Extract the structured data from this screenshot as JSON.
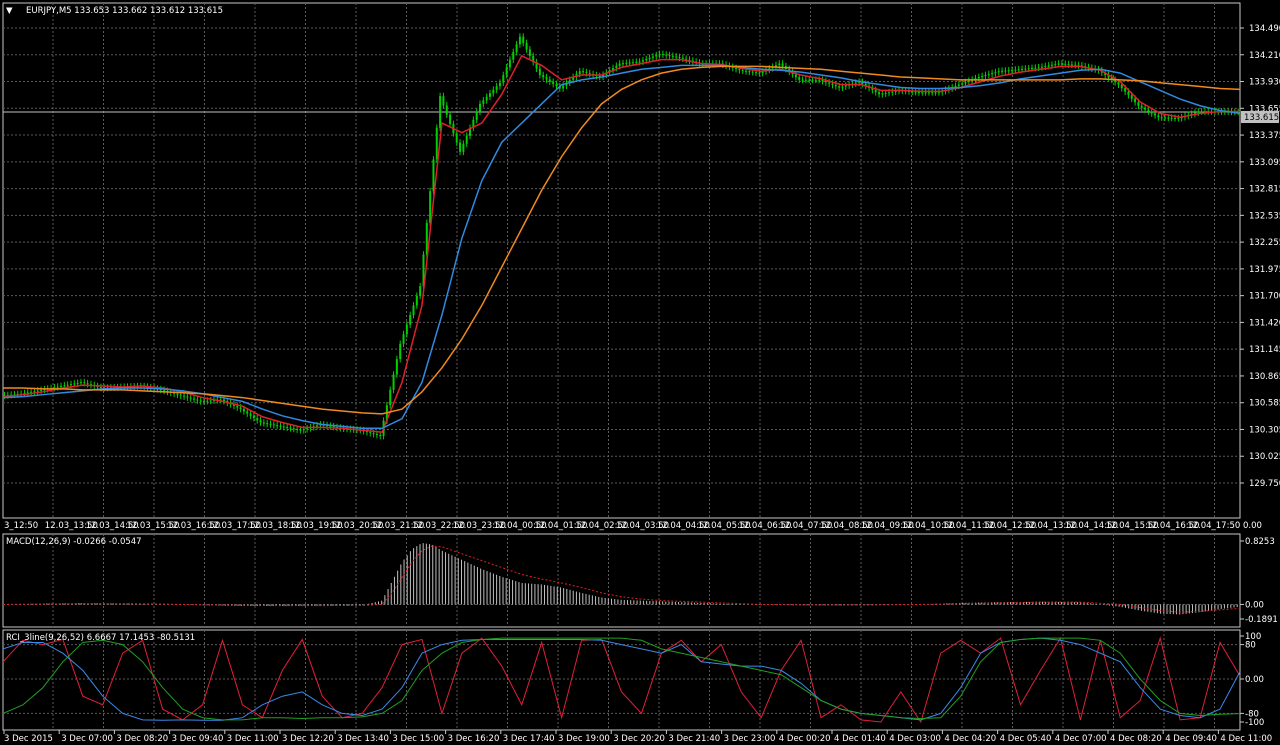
{
  "window": {
    "symbol_header": "EURJPY,M5  133.653 133.662 133.612 133.615",
    "menu_glyph": "▼"
  },
  "colors": {
    "background": "#000000",
    "grid": "#5a5a5a",
    "frame": "#c8c8c8",
    "bull_candle": "#00d000",
    "ma_fast": "#e0202a",
    "ma_mid": "#2f8ae0",
    "ma_slow": "#f08a20",
    "bid_line": "#c0c0c0",
    "macd_hist": "#c0c0c0",
    "macd_signal": "#e02020",
    "rci_short": "#e0203a",
    "rci_mid": "#3a8ae8",
    "rci_long": "#20a020"
  },
  "price_panel": {
    "price_ticks": [
      "134.490",
      "134.210",
      "133.930",
      "133.655",
      "133.375",
      "133.095",
      "132.815",
      "132.535",
      "132.255",
      "131.975",
      "131.700",
      "131.420",
      "131.145",
      "130.865",
      "130.585",
      "130.305",
      "130.025",
      "129.750"
    ],
    "current_price_label": "133.615",
    "time_labels": [
      "3_12:50",
      "12.03_13:50",
      "12.03_14:50",
      "12.03_15:50",
      "12.03_16:50",
      "12.03_17:50",
      "12.03_18:50",
      "12.03_19:50",
      "12.03_20:50",
      "12.03_21:50",
      "12.03_22:50",
      "12.03_23:50",
      "12.04_00:50",
      "12.04_01:50",
      "12.04_02:50",
      "12.04_03:50",
      "12.04_04:50",
      "12.04_05:50",
      "12.04_06:50",
      "12.04_07:50",
      "12.04_08:50",
      "12.04_09:50",
      "12.04_10:50",
      "12.04_11:50",
      "12.04_12:50",
      "12.04_13:50",
      "12.04_14:50",
      "12.04_15:50",
      "12.04_16:50",
      "12.04_17:50"
    ],
    "time_tail_label": "0.00"
  },
  "macd_panel": {
    "title": "MACD(12,26,9) -0.0266 -0.0547",
    "scale": [
      "0.8253",
      "0.00",
      "-0.1891"
    ]
  },
  "rci_panel": {
    "title": "RCI_3line(9,26,52) 6.6667 17.1453 -80.5131",
    "scale": [
      "100",
      "80",
      "0.00",
      "-80",
      "-100"
    ]
  },
  "time_axis": [
    "3 Dec 2015",
    "3 Dec 07:00",
    "3 Dec 08:20",
    "3 Dec 09:40",
    "3 Dec 11:00",
    "3 Dec 12:20",
    "3 Dec 13:40",
    "3 Dec 15:00",
    "3 Dec 16:20",
    "3 Dec 17:40",
    "3 Dec 19:00",
    "3 Dec 20:20",
    "3 Dec 21:40",
    "3 Dec 23:00",
    "4 Dec 00:20",
    "4 Dec 01:40",
    "4 Dec 03:00",
    "4 Dec 04:20",
    "4 Dec 05:40",
    "4 Dec 07:00",
    "4 Dec 08:20",
    "4 Dec 09:40",
    "4 Dec 11:00"
  ],
  "chart_data": [
    {
      "type": "line",
      "title": "EURJPY,M5  133.653 133.662 133.612 133.615",
      "ylim": [
        129.75,
        134.63
      ],
      "x": [
        0,
        20,
        40,
        60,
        80,
        100,
        120,
        140,
        160,
        180,
        200,
        220,
        240,
        260,
        280,
        300,
        320,
        340,
        360,
        380,
        400,
        420,
        440,
        460,
        480,
        500,
        520,
        540,
        560,
        580,
        600,
        620,
        640,
        660,
        680,
        700,
        720,
        740,
        760,
        780,
        800,
        820,
        840,
        860,
        880,
        900,
        920,
        940,
        960,
        980,
        1000,
        1020,
        1040,
        1060,
        1080,
        1100,
        1120,
        1140,
        1160,
        1180,
        1200,
        1220,
        1240
      ],
      "series": [
        {
          "name": "close",
          "values": [
            130.66,
            130.68,
            130.72,
            130.76,
            130.8,
            130.74,
            130.75,
            130.76,
            130.72,
            130.66,
            130.6,
            130.62,
            130.52,
            130.38,
            130.34,
            130.3,
            130.36,
            130.32,
            130.3,
            130.24,
            131.2,
            131.8,
            133.78,
            133.2,
            133.7,
            133.92,
            134.4,
            134.0,
            133.86,
            134.04,
            133.98,
            134.12,
            134.14,
            134.22,
            134.18,
            134.12,
            134.12,
            134.05,
            134.02,
            134.12,
            133.95,
            133.95,
            133.87,
            133.93,
            133.8,
            133.84,
            133.82,
            133.82,
            133.9,
            133.98,
            134.04,
            134.06,
            134.08,
            134.12,
            134.1,
            134.05,
            133.9,
            133.68,
            133.56,
            133.55,
            133.62,
            133.62,
            133.615
          ]
        },
        {
          "name": "",
          "values": [
            130.65,
            130.67,
            130.7,
            130.74,
            130.77,
            130.76,
            130.75,
            130.76,
            130.74,
            130.7,
            130.64,
            130.6,
            130.55,
            130.44,
            130.38,
            130.33,
            130.33,
            130.32,
            130.3,
            130.28,
            130.8,
            131.6,
            133.5,
            133.4,
            133.5,
            133.8,
            134.2,
            134.1,
            133.95,
            134.0,
            134.0,
            134.08,
            134.12,
            134.16,
            134.16,
            134.12,
            134.11,
            134.07,
            134.04,
            134.06,
            134.0,
            133.96,
            133.9,
            133.9,
            133.84,
            133.84,
            133.83,
            133.83,
            133.87,
            133.93,
            133.99,
            134.03,
            134.06,
            134.09,
            134.09,
            134.05,
            133.93,
            133.72,
            133.6,
            133.56,
            133.6,
            133.62,
            133.62
          ]
        },
        {
          "name": "",
          "values": [
            130.64,
            130.65,
            130.67,
            130.69,
            130.71,
            130.73,
            130.74,
            130.74,
            130.73,
            130.71,
            130.68,
            130.64,
            130.6,
            130.52,
            130.45,
            130.4,
            130.36,
            130.34,
            130.32,
            130.32,
            130.42,
            130.8,
            131.5,
            132.3,
            132.9,
            133.3,
            133.5,
            133.7,
            133.9,
            133.95,
            133.98,
            134.02,
            134.06,
            134.08,
            134.1,
            134.1,
            134.1,
            134.08,
            134.06,
            134.05,
            134.03,
            134.0,
            133.97,
            133.93,
            133.9,
            133.87,
            133.86,
            133.86,
            133.87,
            133.89,
            133.92,
            133.96,
            133.99,
            134.02,
            134.05,
            134.06,
            134.02,
            133.93,
            133.84,
            133.75,
            133.68,
            133.63,
            133.6
          ]
        },
        {
          "name": "",
          "values": [
            130.74,
            130.74,
            130.73,
            130.73,
            130.72,
            130.72,
            130.72,
            130.71,
            130.7,
            130.69,
            130.68,
            130.66,
            130.64,
            130.61,
            130.58,
            130.55,
            130.52,
            130.5,
            130.48,
            130.47,
            130.52,
            130.7,
            130.95,
            131.25,
            131.6,
            132.0,
            132.4,
            132.8,
            133.15,
            133.45,
            133.7,
            133.85,
            133.95,
            134.02,
            134.06,
            134.08,
            134.09,
            134.09,
            134.09,
            134.08,
            134.07,
            134.06,
            134.04,
            134.02,
            134.0,
            133.98,
            133.97,
            133.96,
            133.95,
            133.95,
            133.95,
            133.95,
            133.95,
            133.95,
            133.96,
            133.96,
            133.95,
            133.94,
            133.92,
            133.9,
            133.88,
            133.86,
            133.85
          ]
        }
      ]
    },
    {
      "type": "bar",
      "title": "MACD(12,26,9) -0.0266 -0.0547",
      "ylim": [
        -0.1891,
        0.8253
      ],
      "x": [
        0,
        40,
        80,
        120,
        160,
        200,
        240,
        280,
        320,
        360,
        380,
        390,
        400,
        410,
        420,
        430,
        440,
        460,
        480,
        500,
        520,
        540,
        560,
        580,
        600,
        620,
        640,
        660,
        680,
        700,
        720,
        760,
        800,
        840,
        880,
        920,
        960,
        1000,
        1040,
        1080,
        1120,
        1140,
        1160,
        1180,
        1200,
        1220,
        1240
      ],
      "series": [
        {
          "name": "histogram",
          "values": [
            0.0,
            0.01,
            0.015,
            0.01,
            0.0,
            -0.01,
            -0.02,
            -0.02,
            -0.015,
            -0.01,
            0.05,
            0.3,
            0.55,
            0.72,
            0.8,
            0.78,
            0.7,
            0.58,
            0.46,
            0.36,
            0.28,
            0.26,
            0.22,
            0.15,
            0.09,
            0.06,
            0.05,
            0.04,
            0.03,
            0.02,
            0.01,
            -0.005,
            -0.01,
            -0.01,
            -0.005,
            0.0,
            0.02,
            0.03,
            0.035,
            0.03,
            -0.03,
            -0.08,
            -0.12,
            -0.13,
            -0.1,
            -0.06,
            -0.03
          ]
        },
        {
          "name": "signal",
          "values": [
            0.0,
            0.005,
            0.01,
            0.01,
            0.005,
            -0.005,
            -0.01,
            -0.015,
            -0.015,
            -0.012,
            0.0,
            0.15,
            0.35,
            0.55,
            0.7,
            0.76,
            0.75,
            0.66,
            0.57,
            0.48,
            0.39,
            0.33,
            0.28,
            0.22,
            0.15,
            0.1,
            0.07,
            0.05,
            0.04,
            0.03,
            0.02,
            0.0,
            -0.005,
            -0.008,
            -0.006,
            0.0,
            0.01,
            0.02,
            0.03,
            0.03,
            0.0,
            -0.04,
            -0.08,
            -0.1,
            -0.09,
            -0.07,
            -0.05
          ]
        }
      ]
    },
    {
      "type": "line",
      "title": "RCI_3line(9,26,52) 6.6667 17.1453 -80.5131",
      "ylim": [
        -100,
        100
      ],
      "x": [
        0,
        20,
        40,
        60,
        80,
        100,
        120,
        140,
        160,
        180,
        200,
        220,
        240,
        260,
        280,
        300,
        320,
        340,
        360,
        380,
        400,
        420,
        440,
        460,
        480,
        500,
        520,
        540,
        560,
        580,
        600,
        620,
        640,
        660,
        680,
        700,
        720,
        740,
        760,
        780,
        800,
        820,
        840,
        860,
        880,
        900,
        920,
        940,
        960,
        980,
        1000,
        1020,
        1040,
        1060,
        1080,
        1100,
        1120,
        1140,
        1160,
        1180,
        1200,
        1220,
        1240
      ],
      "series": [
        {
          "values": [
            40,
            90,
            80,
            92,
            -40,
            -60,
            60,
            90,
            -70,
            -95,
            -60,
            90,
            -60,
            -90,
            20,
            92,
            -40,
            -90,
            -80,
            -20,
            80,
            92,
            -80,
            60,
            95,
            30,
            -60,
            85,
            -90,
            90,
            92,
            -30,
            -80,
            60,
            90,
            40,
            80,
            -30,
            -90,
            20,
            90,
            -90,
            -60,
            -95,
            -100,
            -30,
            -100,
            60,
            90,
            60,
            95,
            -60,
            20,
            95,
            -95,
            90,
            -90,
            -50,
            95,
            -95,
            -90,
            85,
            6.6667
          ]
        },
        {
          "values": [
            70,
            85,
            85,
            60,
            20,
            -40,
            -80,
            -95,
            -96,
            -95,
            -96,
            -96,
            -90,
            -60,
            -40,
            -30,
            -60,
            -80,
            -85,
            -70,
            -20,
            60,
            80,
            90,
            92,
            92,
            92,
            92,
            92,
            92,
            90,
            80,
            70,
            60,
            80,
            40,
            35,
            30,
            30,
            20,
            -10,
            -50,
            -70,
            -80,
            -85,
            -90,
            -95,
            -80,
            -20,
            60,
            85,
            92,
            95,
            90,
            80,
            60,
            40,
            -20,
            -70,
            -85,
            -90,
            -70,
            17.1453
          ]
        },
        {
          "values": [
            -80,
            -60,
            -20,
            40,
            85,
            90,
            80,
            40,
            -20,
            -70,
            -90,
            -95,
            -95,
            -90,
            -90,
            -92,
            -90,
            -90,
            -88,
            -80,
            -50,
            20,
            60,
            85,
            92,
            95,
            95,
            95,
            95,
            95,
            95,
            95,
            90,
            70,
            60,
            50,
            40,
            30,
            20,
            10,
            -20,
            -50,
            -70,
            -80,
            -85,
            -90,
            -92,
            -90,
            -40,
            40,
            85,
            92,
            95,
            95,
            95,
            90,
            60,
            0,
            -50,
            -80,
            -85,
            -82,
            -80.5131
          ]
        }
      ]
    }
  ]
}
